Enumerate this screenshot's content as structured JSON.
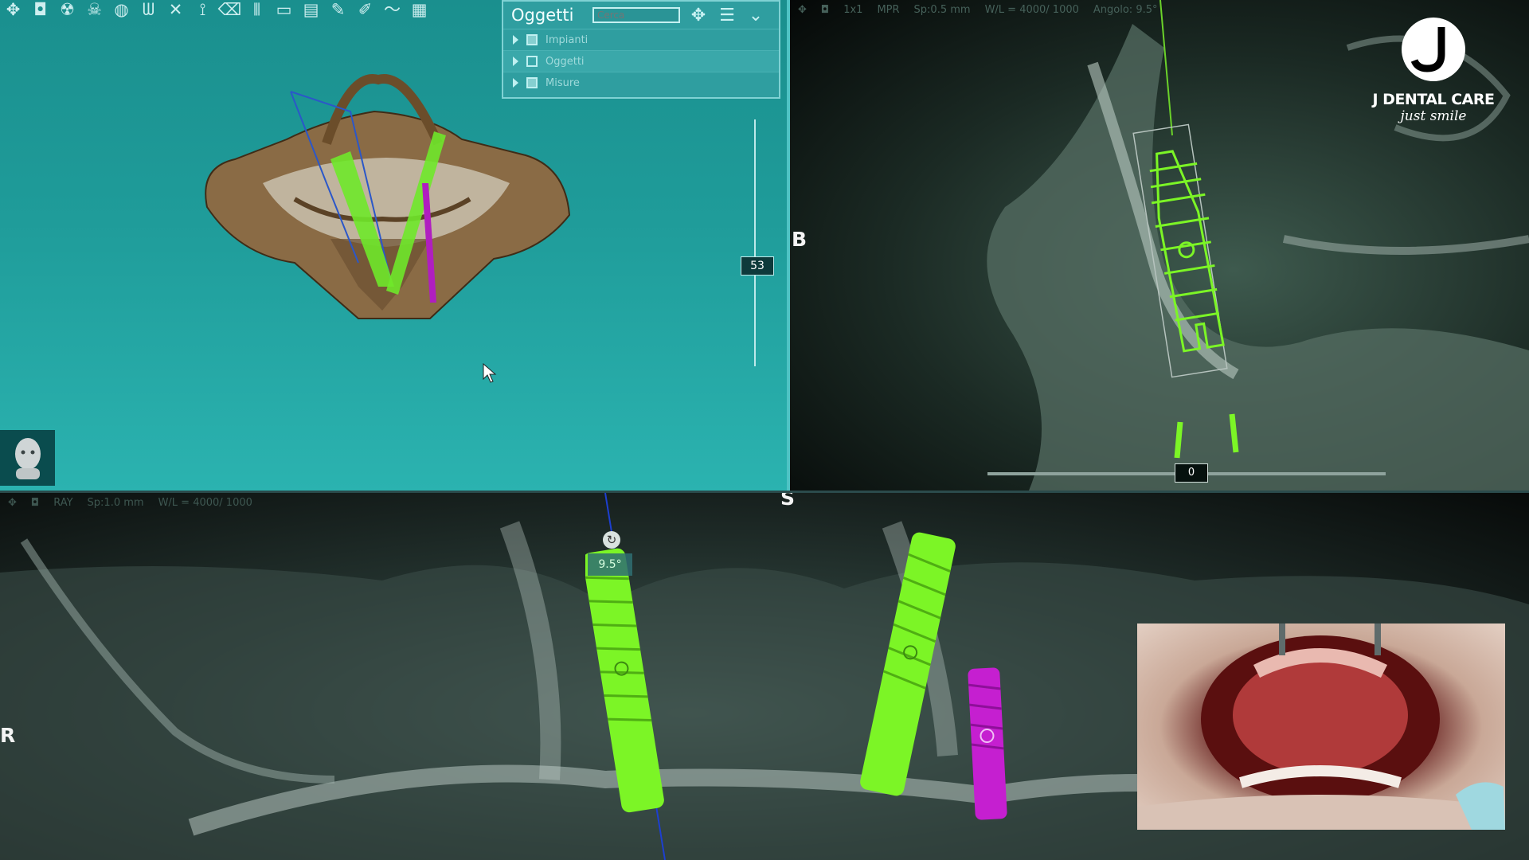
{
  "toolbar": {
    "icons": [
      "move-icon",
      "camera-icon",
      "radiation-icon",
      "skull-icon",
      "sphere-icon",
      "tooth-icon",
      "close-icon",
      "implant-icon",
      "eraser-icon",
      "teeth-icon",
      "print-icon",
      "stack-icon",
      "pen-icon",
      "pen-edit-icon",
      "curve-icon",
      "grid-icon"
    ],
    "glyphs": [
      "✥",
      "◘",
      "☢",
      "☠",
      "◍",
      "ᗯ",
      "✕",
      "⟟",
      "⌫",
      "⫴",
      "▭",
      "▤",
      "✎",
      "✐",
      "〜",
      "▦"
    ]
  },
  "objects_panel": {
    "title": "Oggetti",
    "search_placeholder": "Cerca",
    "items": [
      {
        "label": "Impianti",
        "checked": true
      },
      {
        "label": "Oggetti",
        "checked": false
      },
      {
        "label": "Misure",
        "checked": true
      }
    ]
  },
  "view3d": {
    "depth_value": "53"
  },
  "mpr": {
    "info": {
      "zoom": "1x1",
      "mode": "MPR",
      "spacing": "Sp:0.5 mm",
      "window": "W/L = 4000/ 1000",
      "angle": "Angolo: 9.5°"
    },
    "slider_value": "0",
    "marker": "B"
  },
  "pano": {
    "info": {
      "mode": "RAY",
      "spacing": "Sp:1.0 mm",
      "window": "W/L = 4000/ 1000"
    },
    "marker_top": "S",
    "marker_left": "R",
    "angle_label": "9.5°"
  },
  "logo": {
    "brand": "J DENTAL CARE",
    "tagline": "just smile"
  },
  "colors": {
    "implant_green": "#7cf526",
    "implant_magenta": "#c51fd0",
    "panel_bg": "#2f9ea0"
  }
}
